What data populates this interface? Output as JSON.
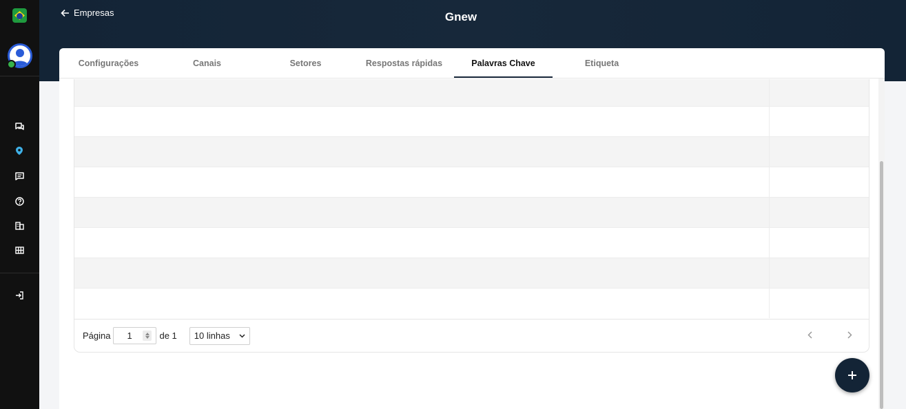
{
  "header": {
    "back_label": "Empresas",
    "title": "Gnew"
  },
  "sidebar": {
    "items": [
      {
        "icon": "chat-icon"
      },
      {
        "icon": "pin-icon"
      },
      {
        "icon": "message-icon"
      },
      {
        "icon": "help-icon"
      },
      {
        "icon": "building-icon"
      },
      {
        "icon": "grid-icon"
      },
      {
        "icon": "logout-icon"
      }
    ],
    "active_color": "#3fb1e8"
  },
  "tabs": [
    {
      "label": "Configurações"
    },
    {
      "label": "Canais"
    },
    {
      "label": "Setores"
    },
    {
      "label": "Respostas rápidas"
    },
    {
      "label": "Palavras Chave",
      "active": true
    },
    {
      "label": "Etiqueta"
    }
  ],
  "pagination": {
    "page_label": "Página",
    "page_value": "1",
    "of_label": "de 1",
    "rows_label": "10 linhas"
  },
  "colors": {
    "header_bg": "#132436",
    "sidebar_bg": "#111111",
    "fab_bg": "#132436"
  }
}
